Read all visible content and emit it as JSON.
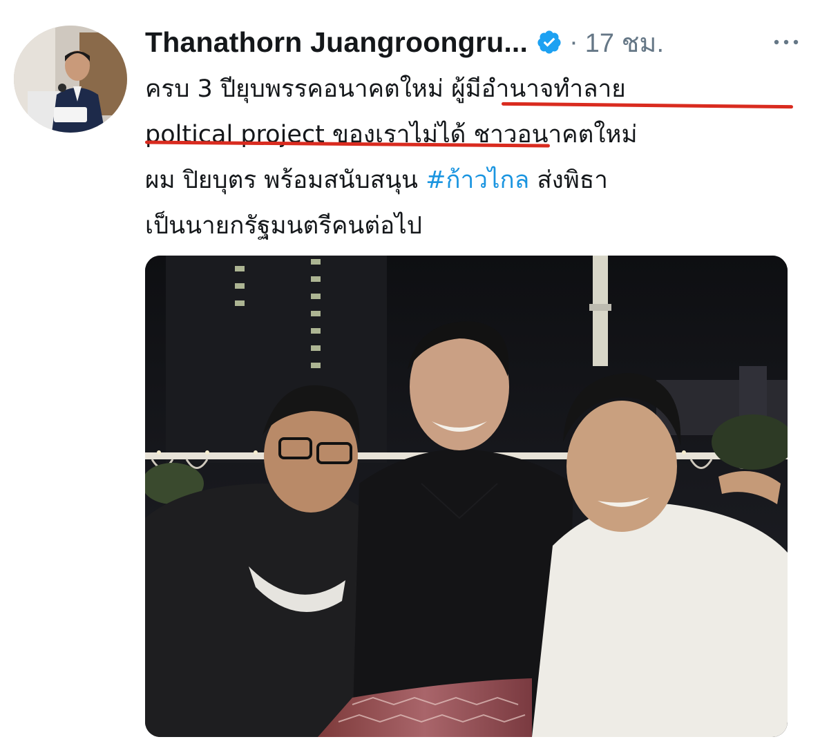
{
  "tweet": {
    "author_name": "Thanathorn Juangroongru...",
    "time_separator": "·",
    "time": "17 ชม.",
    "text_lines": [
      "ครบ 3 ปียุบพรรคอนาคตใหม่ ผู้มีอำนาจทำลาย",
      "poltical project ของเราไม่ได้ ชาวอนาคตใหม่"
    ],
    "line3_prefix": "ผม ปิยบุตร พร้อมสนับสนุน ",
    "hashtag": "#ก้าวไกล",
    "line3_suffix": " ส่งพิธา",
    "line4": "เป็นนายกรัฐมนตรีคนต่อไป"
  },
  "icons": {
    "verified": "verified-badge-icon",
    "more": "more-options-icon"
  },
  "colors": {
    "verified": "#1da1f2",
    "hashtag": "#1b95e0",
    "muted": "#657786",
    "annotation_underline": "#d92b1f"
  }
}
